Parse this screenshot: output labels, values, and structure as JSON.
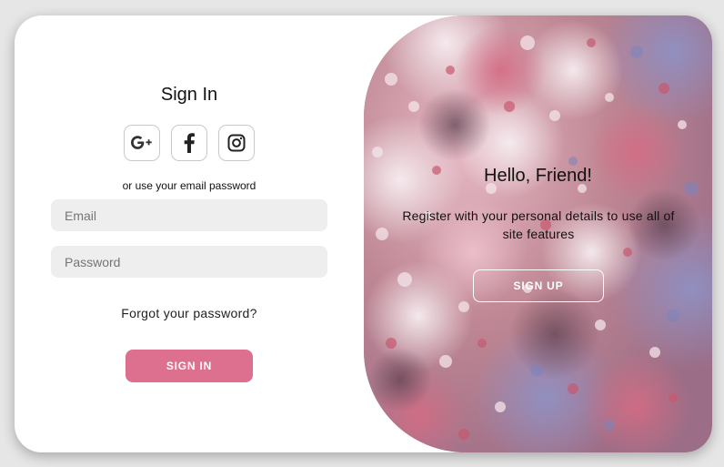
{
  "sign_in": {
    "title": "Sign In",
    "social_icons": [
      "google-plus-icon",
      "facebook-icon",
      "instagram-icon"
    ],
    "hint": "or use your email password",
    "email_placeholder": "Email",
    "password_placeholder": "Password",
    "forgot_label": "Forgot your password?",
    "button_label": "SIGN IN"
  },
  "overlay": {
    "title": "Hello, Friend!",
    "message": "Register with your personal details to use all of site features",
    "button_label": "SIGN UP",
    "background": "cherry-blossom-photo"
  },
  "colors": {
    "accent": "#dd6f8f",
    "field_bg": "#eeeeee",
    "page_bg": "#e6e6e6"
  }
}
